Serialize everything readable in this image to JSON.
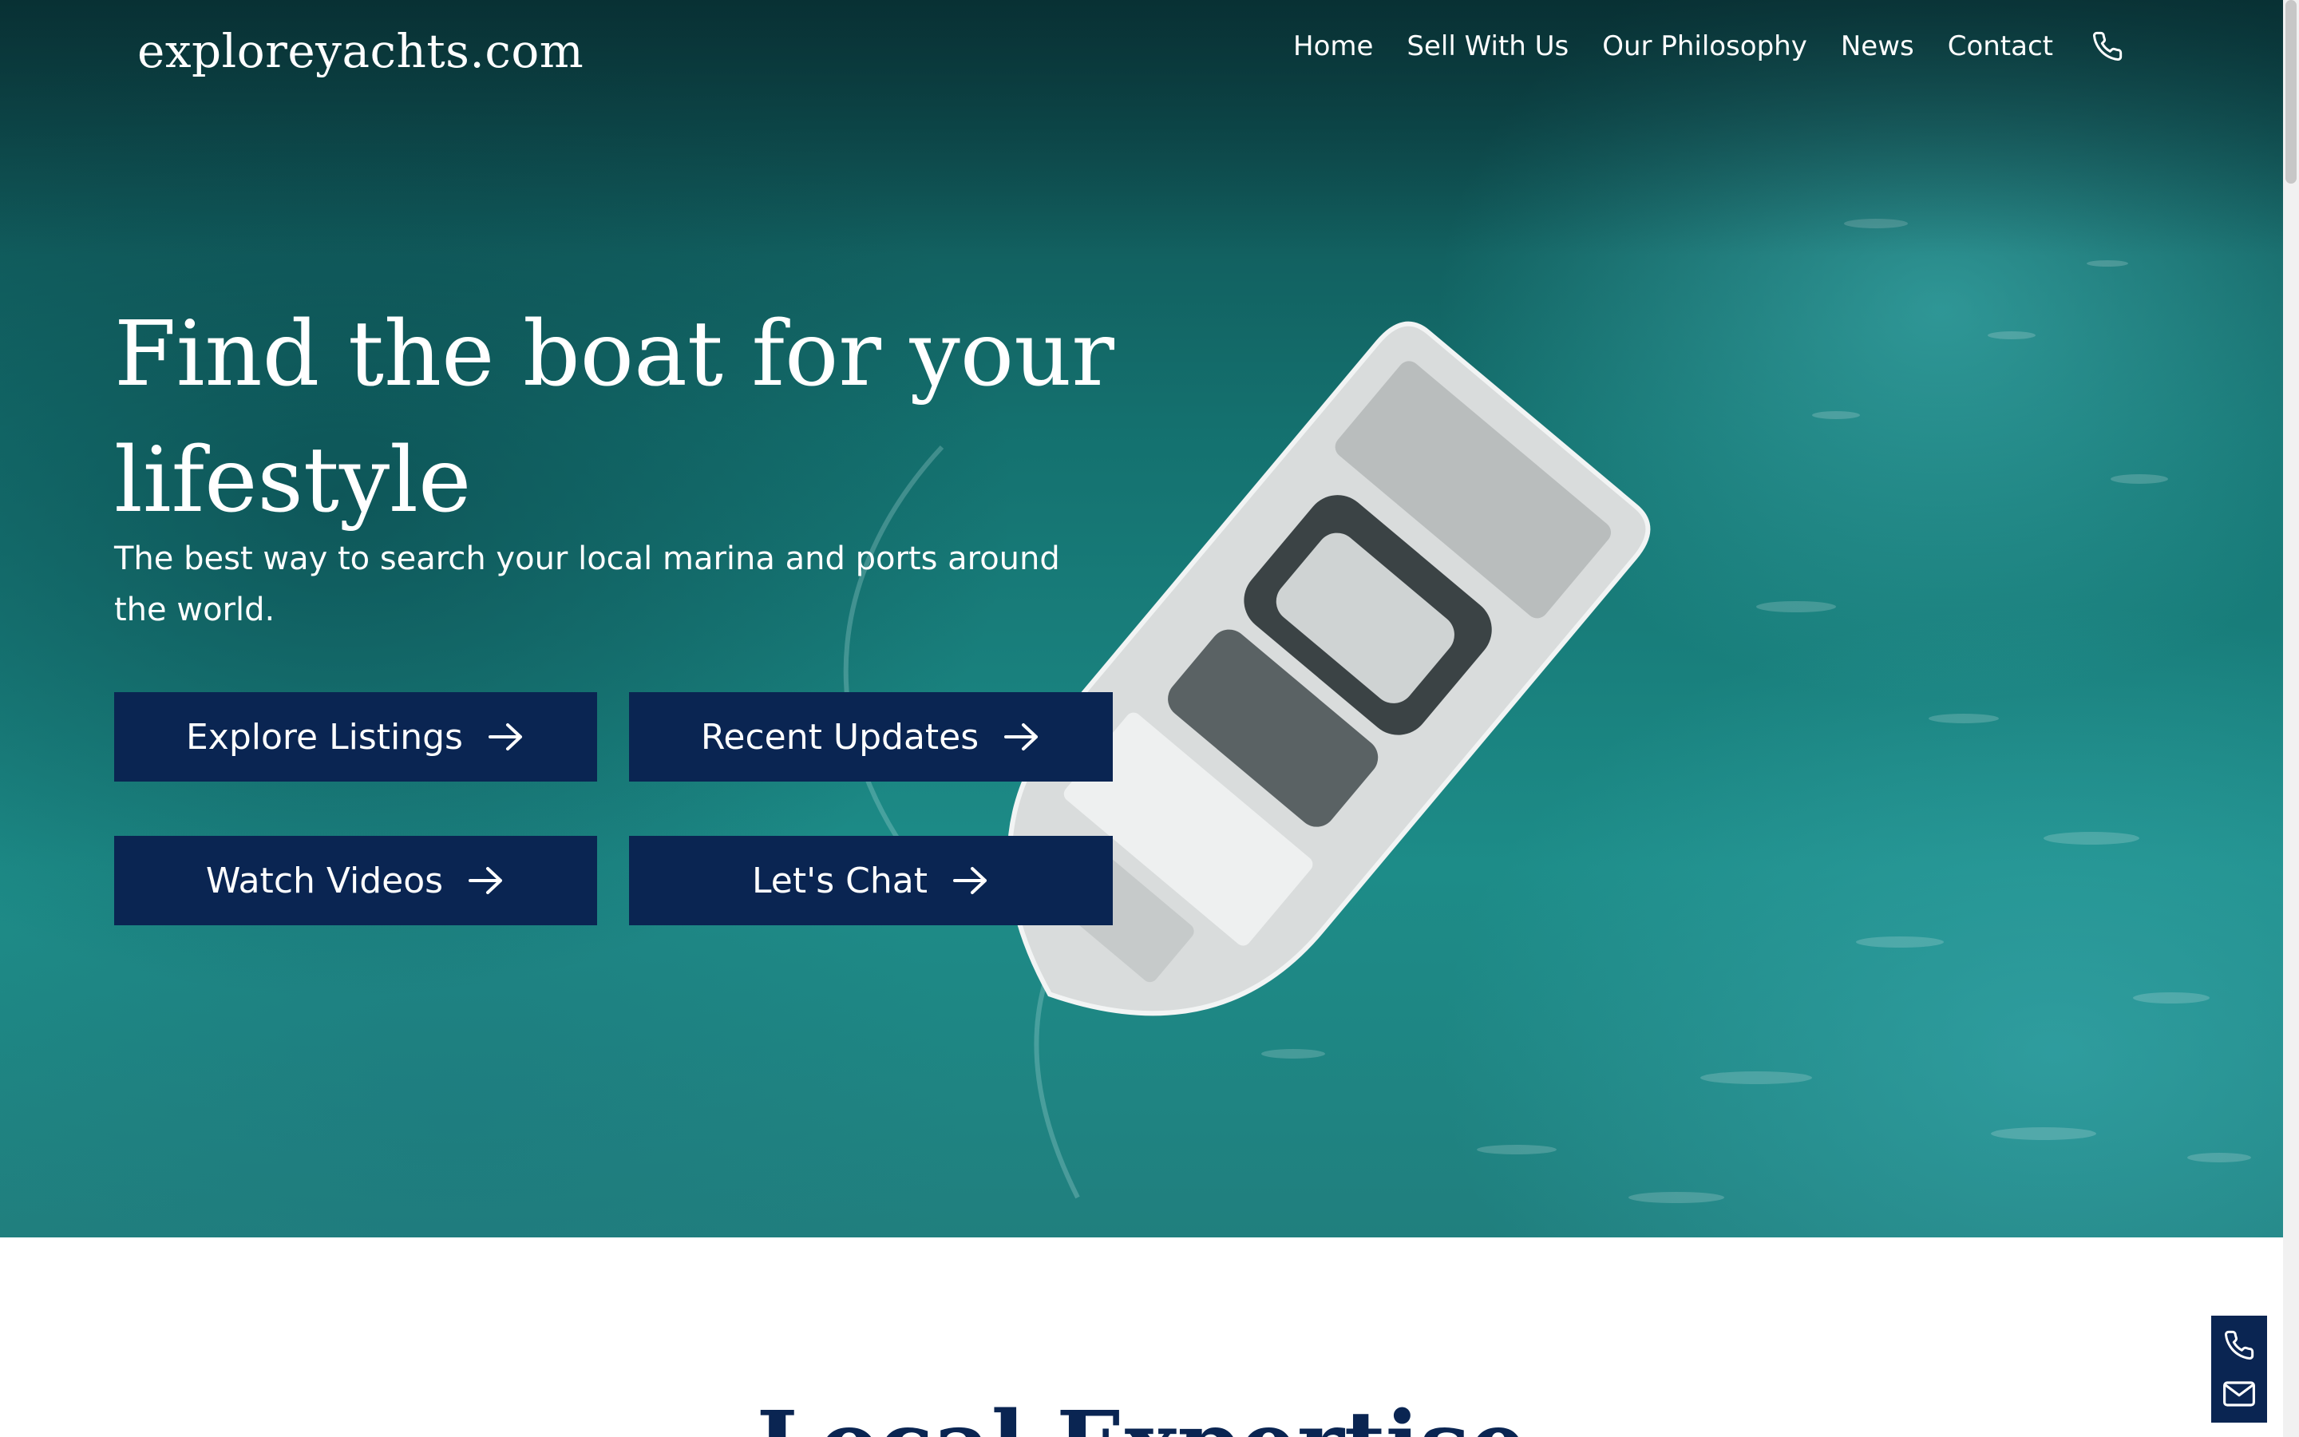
{
  "site": {
    "logo_text": "exploreyachts.com"
  },
  "nav": {
    "items": [
      "Home",
      "Sell With Us",
      "Our Philosophy",
      "News",
      "Contact"
    ],
    "phone_icon": "phone-icon"
  },
  "hero": {
    "headline": "Find the boat for your lifestyle",
    "subheadline": "The best way to search your local marina and ports around the world.",
    "buttons": [
      {
        "label": "Explore Listings",
        "icon": "arrow-right-icon"
      },
      {
        "label": "Recent Updates",
        "icon": "arrow-right-icon"
      },
      {
        "label": "Watch Videos",
        "icon": "arrow-right-icon"
      },
      {
        "label": "Let's Chat",
        "icon": "arrow-right-icon"
      }
    ]
  },
  "section": {
    "title": "Local Expertise"
  },
  "floating_contact": {
    "icons": [
      "phone-icon",
      "envelope-icon"
    ]
  },
  "colors": {
    "navy": "#0a2552",
    "sea": "#1d8c88",
    "text_light": "#ffffff"
  }
}
